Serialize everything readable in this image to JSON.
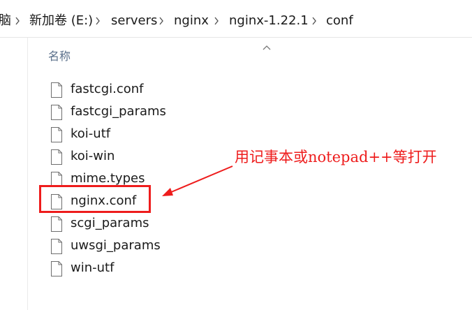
{
  "breadcrumb": {
    "items": [
      "脑",
      "新加卷 (E:)",
      "servers",
      "nginx",
      "nginx-1.22.1",
      "conf"
    ]
  },
  "columns": {
    "name_header": "名称"
  },
  "files": [
    "fastcgi.conf",
    "fastcgi_params",
    "koi-utf",
    "koi-win",
    "mime.types",
    "nginx.conf",
    "scgi_params",
    "uwsgi_params",
    "win-utf"
  ],
  "annotation": {
    "text": "用记事本或notepad++等打开",
    "highlighted_file": "nginx.conf",
    "color": "#ee1c1c"
  },
  "icons": {
    "separator": "chevron-right-icon",
    "sort": "sort-ascending-caret-icon",
    "file": "file-icon"
  }
}
